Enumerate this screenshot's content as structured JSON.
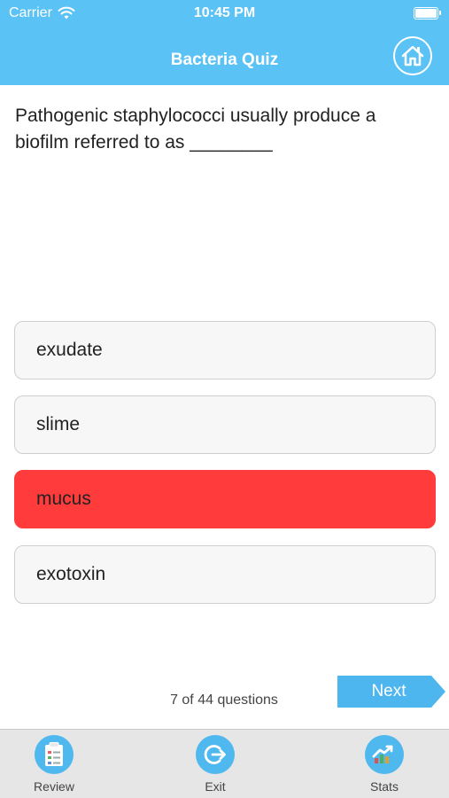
{
  "status_bar": {
    "carrier": "Carrier",
    "time": "10:45 PM"
  },
  "header": {
    "title": "Bacteria Quiz",
    "home_icon": "home-icon"
  },
  "question": {
    "text": "Pathogenic staphylococci usually produce a biofilm referred to as ________"
  },
  "answers": [
    {
      "label": "exudate",
      "state": "default"
    },
    {
      "label": "slime",
      "state": "default"
    },
    {
      "label": "mucus",
      "state": "wrong"
    },
    {
      "label": "exotoxin",
      "state": "default"
    }
  ],
  "footer": {
    "progress": "7 of 44 questions",
    "next_label": "Next"
  },
  "tabs": [
    {
      "label": "Review",
      "icon": "clipboard-icon"
    },
    {
      "label": "Exit",
      "icon": "exit-icon"
    },
    {
      "label": "Stats",
      "icon": "chart-icon"
    }
  ],
  "colors": {
    "accent": "#5bc2f5",
    "wrong": "#ff3b3b",
    "tab_icon": "#4fb8ef",
    "next": "#4db6ee"
  }
}
